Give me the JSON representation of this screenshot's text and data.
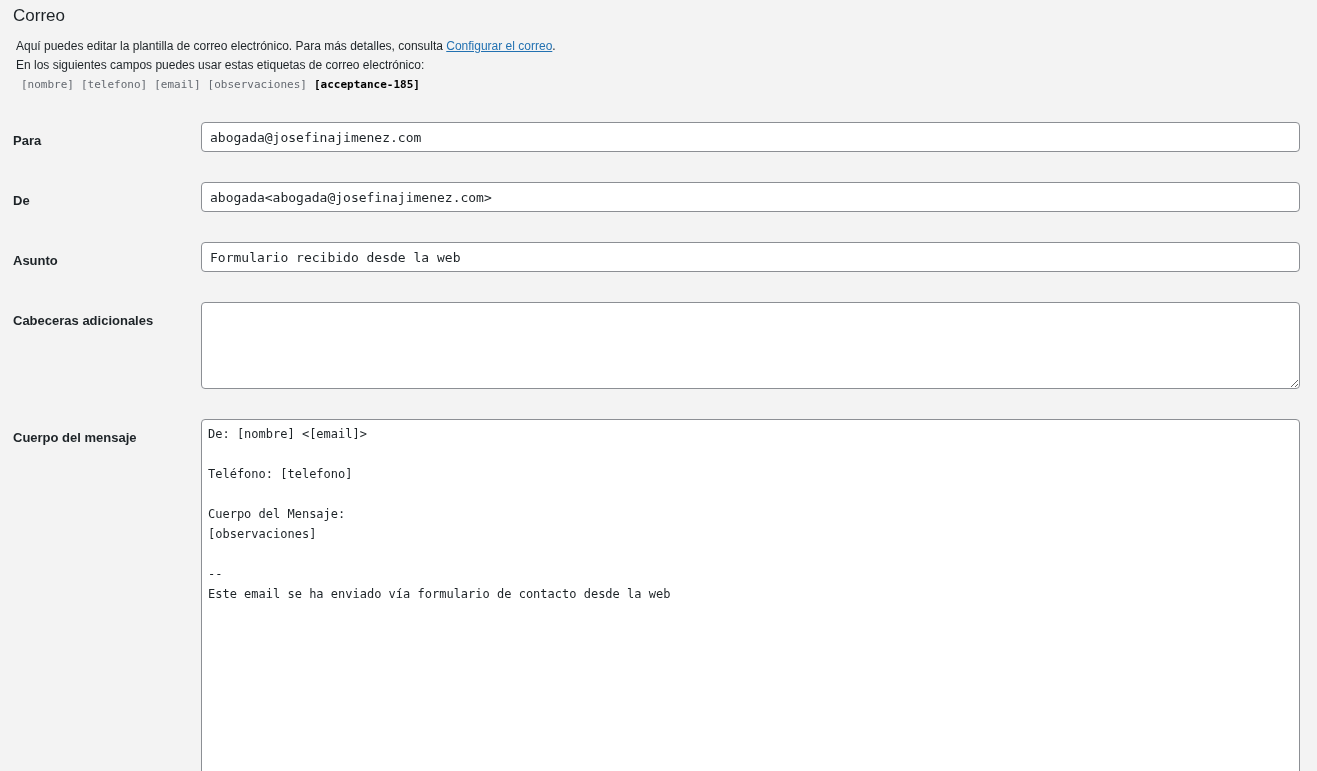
{
  "section_title": "Correo",
  "intro": {
    "text": "Aquí puedes editar la plantilla de correo electrónico. Para más detalles, consulta ",
    "link": "Configurar el correo",
    "after": "."
  },
  "tags_intro": "En los siguientes campos puedes usar estas etiquetas de correo electrónico:",
  "tags": [
    {
      "text": "[nombre]",
      "emphasized": false
    },
    {
      "text": "[telefono]",
      "emphasized": false
    },
    {
      "text": "[email]",
      "emphasized": false
    },
    {
      "text": "[observaciones]",
      "emphasized": false
    },
    {
      "text": "[acceptance-185]",
      "emphasized": true
    }
  ],
  "fields": [
    {
      "label": "Para",
      "kind": "input",
      "value": "abogada@josefinajimenez.com"
    },
    {
      "label": "De",
      "kind": "input",
      "value": "abogada<abogada@josefinajimenez.com>"
    },
    {
      "label": "Asunto",
      "kind": "input",
      "value": "Formulario recibido desde la web"
    },
    {
      "label": "Cabeceras adicionales",
      "kind": "textarea"
    },
    {
      "label": "Cuerpo del mensaje",
      "kind": "body",
      "value": "De: [nombre] <[email]>\n\nTeléfono: [telefono]\n\nCuerpo del Mensaje:\n[observaciones]\n\n--\nEste email se ha enviado vía formulario de contacto desde la web"
    }
  ]
}
